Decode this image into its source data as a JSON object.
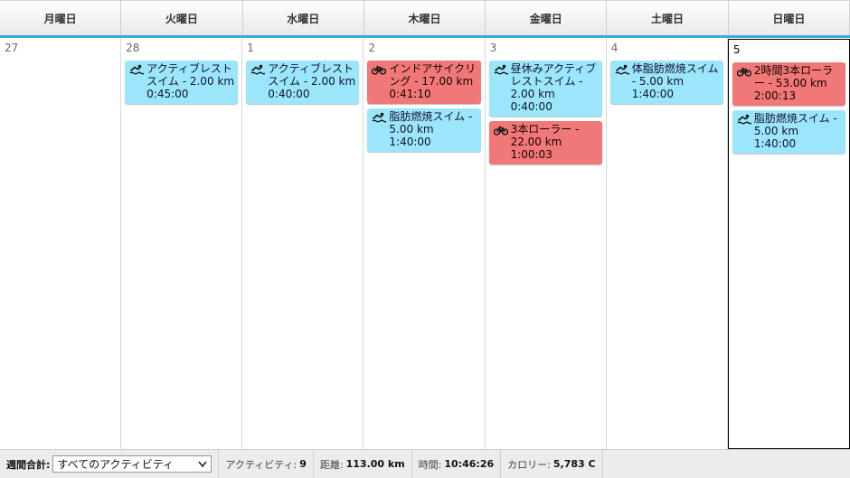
{
  "weekdays": [
    "月曜日",
    "火曜日",
    "水曜日",
    "木曜日",
    "金曜日",
    "土曜日",
    "日曜日"
  ],
  "days": [
    {
      "num": "27",
      "events": []
    },
    {
      "num": "28",
      "events": [
        {
          "type": "swim",
          "icon": "swim-icon",
          "text": "アクティブレストスイム - 2.00 km 0:45:00"
        }
      ]
    },
    {
      "num": "1",
      "events": [
        {
          "type": "swim",
          "icon": "swim-icon",
          "text": "アクティブレストスイム - 2.00 km 0:40:00"
        }
      ]
    },
    {
      "num": "2",
      "events": [
        {
          "type": "bike",
          "icon": "bike-icon",
          "text": "インドアサイクリング - 17.00 km 0:41:10"
        },
        {
          "type": "swim",
          "icon": "swim-icon",
          "text": "脂肪燃焼スイム - 5.00 km 1:40:00"
        }
      ]
    },
    {
      "num": "3",
      "events": [
        {
          "type": "swim",
          "icon": "swim-icon",
          "text": "昼休みアクティブレストスイム - 2.00 km 0:40:00"
        },
        {
          "type": "bike",
          "icon": "bike-icon",
          "text": "3本ローラー - 22.00 km 1:00:03"
        }
      ]
    },
    {
      "num": "4",
      "events": [
        {
          "type": "swim",
          "icon": "swim-icon",
          "text": "体脂肪燃焼スイム - 5.00 km 1:40:00"
        }
      ]
    },
    {
      "num": "5",
      "today": true,
      "events": [
        {
          "type": "bike",
          "icon": "bike-icon",
          "text": "2時間3本ローラー - 53.00 km 2:00:13"
        },
        {
          "type": "swim",
          "icon": "swim-icon",
          "text": "脂肪燃焼スイム - 5.00 km 1:40:00"
        }
      ]
    }
  ],
  "footer": {
    "weekly_total_label": "週間合計:",
    "filter_selected": "すべてのアクティビティ",
    "activities_label": "アクティビティ:",
    "activities_value": "9",
    "distance_label": "距離:",
    "distance_value": "113.00 km",
    "time_label": "時間:",
    "time_value": "10:46:26",
    "calories_label": "カロリー:",
    "calories_value": "5,783 C"
  },
  "colors": {
    "swim": "#9be6fb",
    "bike": "#f07878",
    "accent": "#3aa9e0"
  }
}
